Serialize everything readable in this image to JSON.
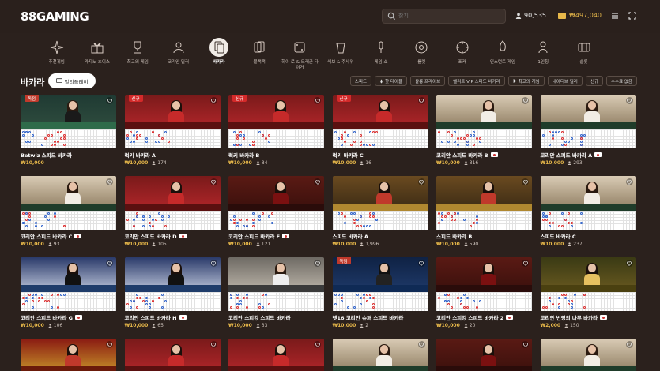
{
  "header": {
    "logo": "88GAMING",
    "search_placeholder": "찾기",
    "online_users": "90,535",
    "balance": "₩497,040"
  },
  "categories": [
    {
      "label": "추천게임",
      "icon": "sparkle-icon"
    },
    {
      "label": "카지노 초이스",
      "icon": "gift-icon"
    },
    {
      "label": "최고의 게임",
      "icon": "trophy-icon"
    },
    {
      "label": "코리안 딜러",
      "icon": "dealer-icon"
    },
    {
      "label": "바카라",
      "icon": "baccarat-icon",
      "active": true
    },
    {
      "label": "블랙잭",
      "icon": "cards-icon"
    },
    {
      "label": "하이 로 & 드래곤 타이거",
      "icon": "dice-icon"
    },
    {
      "label": "식보 & 주사위",
      "icon": "dice-cup-icon"
    },
    {
      "label": "게임 쇼",
      "icon": "mic-icon"
    },
    {
      "label": "룰렛",
      "icon": "roulette-icon"
    },
    {
      "label": "포커",
      "icon": "poker-chip-icon"
    },
    {
      "label": "인스턴트 게임",
      "icon": "rocket-icon"
    },
    {
      "label": "1인칭",
      "icon": "person-icon"
    },
    {
      "label": "슬롯",
      "icon": "slot-icon"
    }
  ],
  "section": {
    "title": "바카라",
    "multiplay_label": "멀티플레이"
  },
  "filters": [
    {
      "label": "스피드"
    },
    {
      "label": "핫 테이블",
      "icon": "fire-icon"
    },
    {
      "label": "살롱 프라이브"
    },
    {
      "label": "엘리트 VIP 스피드 바카라"
    },
    {
      "label": "최고의 게임",
      "icon": "play-icon"
    },
    {
      "label": "네이티브 딜러"
    },
    {
      "label": "신규"
    },
    {
      "label": "수수료 없음"
    }
  ],
  "cards": [
    {
      "name": "Betwiz 스피드 바카라",
      "min": "₩10,000",
      "count": "",
      "badge": "독점",
      "flag": false,
      "theme": "green"
    },
    {
      "name": "럭키 바카라 A",
      "min": "₩10,000",
      "count": "174",
      "badge": "신규",
      "flag": false,
      "theme": "red"
    },
    {
      "name": "럭키 바카라 B",
      "min": "₩10,000",
      "count": "84",
      "badge": "신규",
      "flag": false,
      "theme": "red"
    },
    {
      "name": "럭키 바카라 C",
      "min": "₩10,000",
      "count": "16",
      "badge": "신규",
      "flag": false,
      "theme": "red"
    },
    {
      "name": "코리안 스피드 바카라 B",
      "min": "₩10,000",
      "count": "316",
      "badge": "",
      "flag": true,
      "theme": "cream"
    },
    {
      "name": "코리안 스피드 바카라 A",
      "min": "₩10,000",
      "count": "293",
      "badge": "",
      "flag": true,
      "theme": "cream"
    },
    {
      "name": "코리안 스피드 바카라 C",
      "min": "₩10,000",
      "count": "93",
      "badge": "",
      "flag": true,
      "theme": "cream"
    },
    {
      "name": "코리안 스피드 바카라 D",
      "min": "₩10,000",
      "count": "105",
      "badge": "",
      "flag": true,
      "theme": "red"
    },
    {
      "name": "코리안 스피드 바카라 E",
      "min": "₩10,000",
      "count": "121",
      "badge": "",
      "flag": true,
      "theme": "maroon"
    },
    {
      "name": "스피드 바카라 A",
      "min": "₩10,000",
      "count": "1,996",
      "badge": "",
      "flag": false,
      "theme": "gold"
    },
    {
      "name": "스피드 바카라 B",
      "min": "₩10,000",
      "count": "590",
      "badge": "",
      "flag": false,
      "theme": "gold"
    },
    {
      "name": "스피드 바카라 C",
      "min": "₩10,000",
      "count": "237",
      "badge": "",
      "flag": false,
      "theme": "cream"
    },
    {
      "name": "코리안 스피드 바카라 G",
      "min": "₩10,000",
      "count": "106",
      "badge": "",
      "flag": true,
      "theme": "blue"
    },
    {
      "name": "코리안 스피드 바카라 H",
      "min": "₩10,000",
      "count": "65",
      "badge": "",
      "flag": true,
      "theme": "blue"
    },
    {
      "name": "코리안 스피킹 스피드 바카라",
      "min": "₩10,000",
      "count": "33",
      "badge": "",
      "flag": false,
      "theme": "gray"
    },
    {
      "name": "벳16 코리안 슈퍼 스피드 바카라",
      "min": "₩10,000",
      "count": "2",
      "badge": "독점",
      "flag": false,
      "theme": "navy"
    },
    {
      "name": "코리안 스피킹 스피드 바카라 2",
      "min": "₩10,000",
      "count": "20",
      "badge": "",
      "flag": true,
      "theme": "maroon"
    },
    {
      "name": "코리안 번영의 나무 바카라",
      "min": "₩2,000",
      "count": "150",
      "badge": "",
      "flag": true,
      "theme": "olive"
    },
    {
      "name": "",
      "min": "",
      "count": "",
      "badge": "",
      "flag": false,
      "theme": "redgold"
    },
    {
      "name": "",
      "min": "",
      "count": "",
      "badge": "",
      "flag": false,
      "theme": "red"
    },
    {
      "name": "",
      "min": "",
      "count": "",
      "badge": "",
      "flag": false,
      "theme": "red"
    },
    {
      "name": "",
      "min": "",
      "count": "",
      "badge": "",
      "flag": false,
      "theme": "cream"
    },
    {
      "name": "",
      "min": "",
      "count": "",
      "badge": "",
      "flag": false,
      "theme": "maroon"
    },
    {
      "name": "",
      "min": "",
      "count": "",
      "badge": "",
      "flag": false,
      "theme": "cream"
    }
  ],
  "colors": {
    "background": "#2b211d",
    "accent_gold": "#e7b84a",
    "badge_red": "#d42a2a"
  }
}
